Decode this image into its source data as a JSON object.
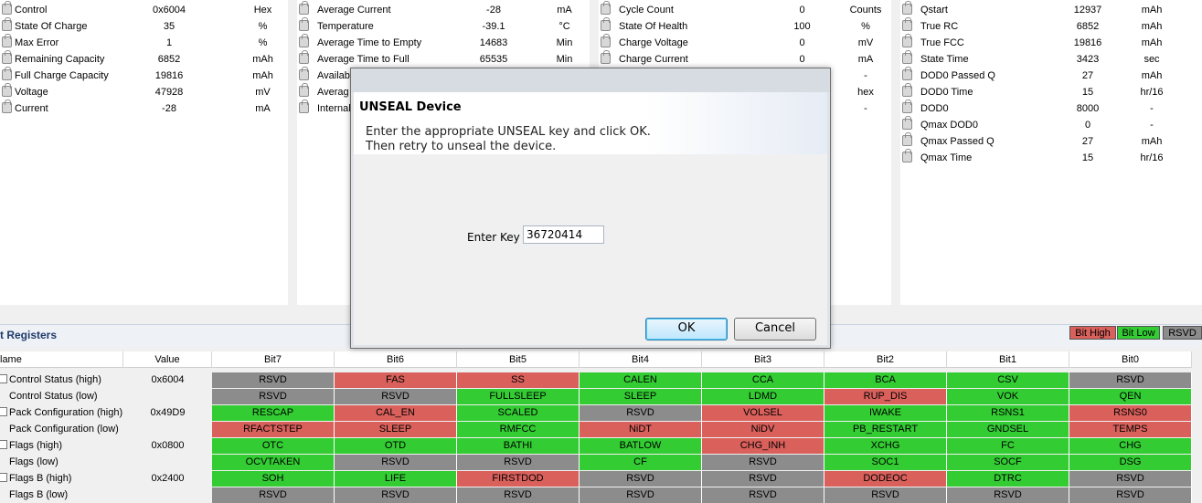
{
  "panels": [
    {
      "rows": [
        {
          "name": "Control",
          "value": "0x6004",
          "unit": "Hex"
        },
        {
          "name": "State Of Charge",
          "value": "35",
          "unit": "%"
        },
        {
          "name": "Max Error",
          "value": "1",
          "unit": "%"
        },
        {
          "name": "Remaining Capacity",
          "value": "6852",
          "unit": "mAh"
        },
        {
          "name": "Full Charge Capacity",
          "value": "19816",
          "unit": "mAh"
        },
        {
          "name": "Voltage",
          "value": "47928",
          "unit": "mV"
        },
        {
          "name": "Current",
          "value": "-28",
          "unit": "mA"
        }
      ]
    },
    {
      "rows": [
        {
          "name": "Average Current",
          "value": "-28",
          "unit": "mA"
        },
        {
          "name": "Temperature",
          "value": "-39.1",
          "unit": "°C"
        },
        {
          "name": "Average Time to Empty",
          "value": "14683",
          "unit": "Min"
        },
        {
          "name": "Average Time to Full",
          "value": "65535",
          "unit": "Min"
        },
        {
          "name": "Availab",
          "value": "",
          "unit": ""
        },
        {
          "name": "Averag",
          "value": "",
          "unit": ""
        },
        {
          "name": "Internal",
          "value": "",
          "unit": ""
        }
      ]
    },
    {
      "rows": [
        {
          "name": "Cycle Count",
          "value": "0",
          "unit": "Counts"
        },
        {
          "name": "State Of Health",
          "value": "100",
          "unit": "%"
        },
        {
          "name": "Charge Voltage",
          "value": "0",
          "unit": "mV"
        },
        {
          "name": "Charge Current",
          "value": "0",
          "unit": "mA"
        },
        {
          "name": "",
          "value": "",
          "unit": "-"
        },
        {
          "name": "",
          "value": "",
          "unit": "hex"
        },
        {
          "name": "",
          "value": "",
          "unit": "-"
        }
      ]
    },
    {
      "rows": [
        {
          "name": "Qstart",
          "value": "12937",
          "unit": "mAh"
        },
        {
          "name": "True RC",
          "value": "6852",
          "unit": "mAh"
        },
        {
          "name": "True FCC",
          "value": "19816",
          "unit": "mAh"
        },
        {
          "name": "State Time",
          "value": "3423",
          "unit": "sec"
        },
        {
          "name": "DOD0 Passed Q",
          "value": "27",
          "unit": "mAh"
        },
        {
          "name": "DOD0 Time",
          "value": "15",
          "unit": "hr/16"
        },
        {
          "name": "DOD0",
          "value": "8000",
          "unit": "-"
        },
        {
          "name": "Qmax DOD0",
          "value": "0",
          "unit": "-"
        },
        {
          "name": "Qmax Passed Q",
          "value": "27",
          "unit": "mAh"
        },
        {
          "name": "Qmax Time",
          "value": "15",
          "unit": "hr/16"
        }
      ]
    }
  ],
  "registers": {
    "title": "t Registers",
    "legend": {
      "high": "Bit High",
      "low": "Bit Low",
      "rsvd": "RSVD"
    },
    "headers": [
      "lame",
      "Value",
      "Bit7",
      "Bit6",
      "Bit5",
      "Bit4",
      "Bit3",
      "Bit2",
      "Bit1",
      "Bit0"
    ],
    "rows": [
      {
        "name": "Control Status (high)",
        "value": "0x6004",
        "checkbox": true,
        "bits": [
          [
            "RSVD",
            "rs"
          ],
          [
            "FAS",
            "hi"
          ],
          [
            "SS",
            "hi"
          ],
          [
            "CALEN",
            "lo"
          ],
          [
            "CCA",
            "lo"
          ],
          [
            "BCA",
            "lo"
          ],
          [
            "CSV",
            "lo"
          ],
          [
            "RSVD",
            "rs"
          ]
        ]
      },
      {
        "name": "Control Status (low)",
        "value": "",
        "checkbox": false,
        "bits": [
          [
            "RSVD",
            "rs"
          ],
          [
            "RSVD",
            "rs"
          ],
          [
            "FULLSLEEP",
            "lo"
          ],
          [
            "SLEEP",
            "lo"
          ],
          [
            "LDMD",
            "lo"
          ],
          [
            "RUP_DIS",
            "hi"
          ],
          [
            "VOK",
            "lo"
          ],
          [
            "QEN",
            "lo"
          ]
        ]
      },
      {
        "name": "Pack Configuration (high)",
        "value": "0x49D9",
        "checkbox": true,
        "bits": [
          [
            "RESCAP",
            "lo"
          ],
          [
            "CAL_EN",
            "hi"
          ],
          [
            "SCALED",
            "lo"
          ],
          [
            "RSVD",
            "rs"
          ],
          [
            "VOLSEL",
            "hi"
          ],
          [
            "IWAKE",
            "lo"
          ],
          [
            "RSNS1",
            "lo"
          ],
          [
            "RSNS0",
            "hi"
          ]
        ]
      },
      {
        "name": "Pack Configuration (low)",
        "value": "",
        "checkbox": false,
        "bits": [
          [
            "RFACTSTEP",
            "hi"
          ],
          [
            "SLEEP",
            "hi"
          ],
          [
            "RMFCC",
            "lo"
          ],
          [
            "NiDT",
            "hi"
          ],
          [
            "NiDV",
            "hi"
          ],
          [
            "PB_RESTART",
            "lo"
          ],
          [
            "GNDSEL",
            "lo"
          ],
          [
            "TEMPS",
            "hi"
          ]
        ]
      },
      {
        "name": "Flags (high)",
        "value": "0x0800",
        "checkbox": true,
        "bits": [
          [
            "OTC",
            "lo"
          ],
          [
            "OTD",
            "lo"
          ],
          [
            "BATHI",
            "lo"
          ],
          [
            "BATLOW",
            "lo"
          ],
          [
            "CHG_INH",
            "hi"
          ],
          [
            "XCHG",
            "lo"
          ],
          [
            "FC",
            "lo"
          ],
          [
            "CHG",
            "lo"
          ]
        ]
      },
      {
        "name": "Flags (low)",
        "value": "",
        "checkbox": false,
        "bits": [
          [
            "OCVTAKEN",
            "lo"
          ],
          [
            "RSVD",
            "rs"
          ],
          [
            "RSVD",
            "rs"
          ],
          [
            "CF",
            "lo"
          ],
          [
            "RSVD",
            "rs"
          ],
          [
            "SOC1",
            "lo"
          ],
          [
            "SOCF",
            "lo"
          ],
          [
            "DSG",
            "lo"
          ]
        ]
      },
      {
        "name": "Flags B (high)",
        "value": "0x2400",
        "checkbox": true,
        "bits": [
          [
            "SOH",
            "lo"
          ],
          [
            "LIFE",
            "lo"
          ],
          [
            "FIRSTDOD",
            "hi"
          ],
          [
            "RSVD",
            "rs"
          ],
          [
            "RSVD",
            "rs"
          ],
          [
            "DODEOC",
            "hi"
          ],
          [
            "DTRC",
            "lo"
          ],
          [
            "RSVD",
            "rs"
          ]
        ]
      },
      {
        "name": "Flags B (low)",
        "value": "",
        "checkbox": false,
        "bits": [
          [
            "RSVD",
            "rs"
          ],
          [
            "RSVD",
            "rs"
          ],
          [
            "RSVD",
            "rs"
          ],
          [
            "RSVD",
            "rs"
          ],
          [
            "RSVD",
            "rs"
          ],
          [
            "RSVD",
            "rs"
          ],
          [
            "RSVD",
            "rs"
          ],
          [
            "RSVD",
            "rs"
          ]
        ]
      }
    ]
  },
  "dialog": {
    "title": "UNSEAL Device",
    "message_line1": "Enter the appropriate UNSEAL key and click OK.",
    "message_line2": "Then retry to unseal the device.",
    "key_label": "Enter Key",
    "key_value": "36720414",
    "ok_label": "OK",
    "cancel_label": "Cancel"
  },
  "colors": {
    "bit_high": "#d9605b",
    "bit_low": "#33cc33",
    "rsvd": "#8c8c8c"
  }
}
